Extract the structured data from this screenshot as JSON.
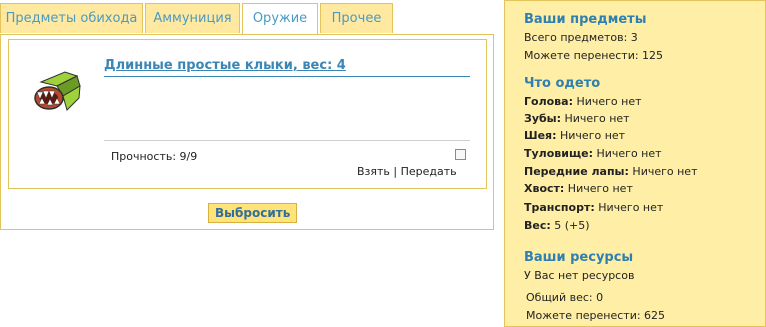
{
  "tabs": [
    {
      "label": "Предметы обихода",
      "active": false
    },
    {
      "label": "Аммуниция",
      "active": false
    },
    {
      "label": "Оружие",
      "active": true
    },
    {
      "label": "Прочее",
      "active": false
    }
  ],
  "item": {
    "title": "Длинные простые клыки, вес: 4",
    "icon": "fangs-icon",
    "durability": "Прочность: 9/9",
    "take_label": "Взять",
    "separator": "|",
    "give_label": "Передать",
    "checked": false
  },
  "drop_button": "Выбросить",
  "sidebar": {
    "my_items": {
      "heading": "Ваши предметы",
      "total": "Всего предметов: 3",
      "can_carry": "Можете перенести: 125"
    },
    "equipped": {
      "heading": "Что одето",
      "slots": [
        {
          "label": "Голова:",
          "value": "Ничего нет"
        },
        {
          "label": "Зубы:",
          "value": "Ничего нет"
        },
        {
          "label": "Шея:",
          "value": "Ничего нет"
        },
        {
          "label": "Туловище:",
          "value": "Ничего нет"
        },
        {
          "label": "Передние лапы:",
          "value": "Ничего нет"
        },
        {
          "label": "Хвост:",
          "value": "Ничего нет"
        },
        {
          "label": "Транспорт:",
          "value": "Ничего нет"
        },
        {
          "label": "Вес:",
          "value": "5 (+5)"
        }
      ]
    },
    "resources": {
      "heading": "Ваши ресурсы",
      "none": "У Вас нет ресурсов",
      "total_weight": "Общий вес: 0",
      "can_carry": "Можете перенести: 625"
    }
  },
  "colors": {
    "accent": "#4a9bc2",
    "tab_bg": "#ffe8a0",
    "sidebar_bg": "#ffefa6",
    "border": "#e2c45a"
  }
}
